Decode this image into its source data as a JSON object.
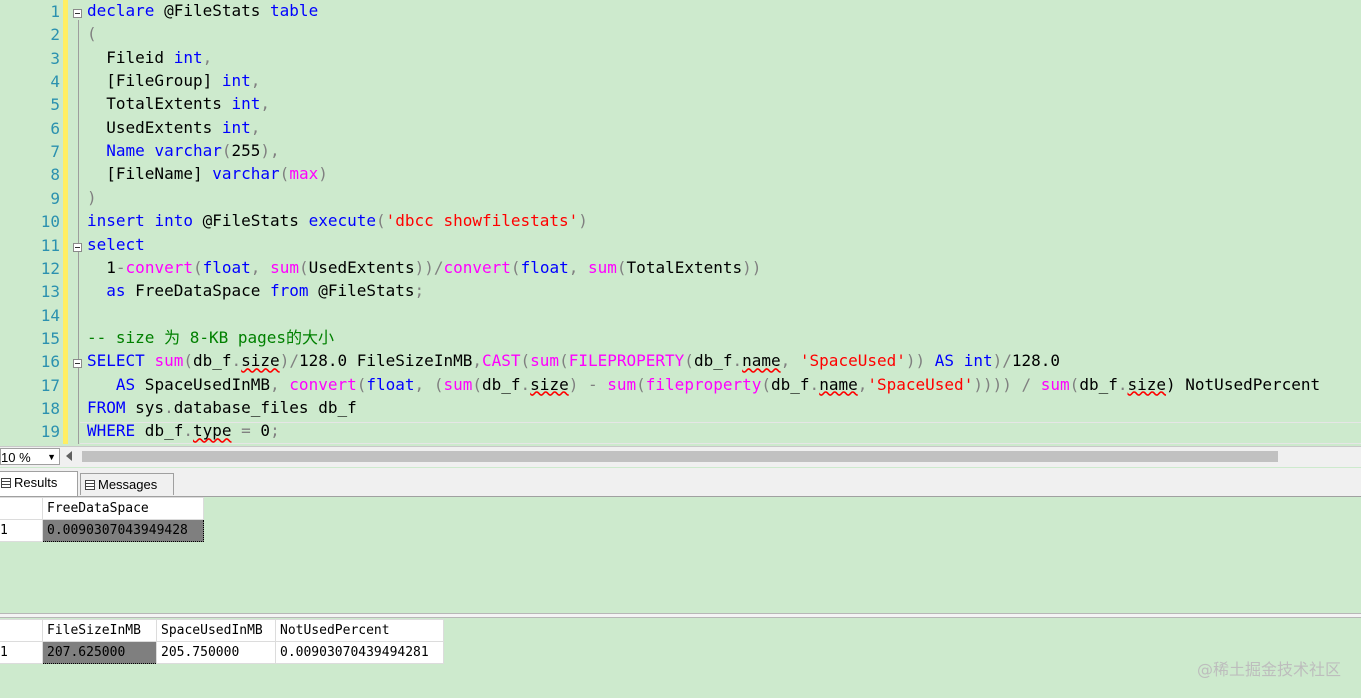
{
  "editor": {
    "line_numbers": [
      "1",
      "2",
      "3",
      "4",
      "5",
      "6",
      "7",
      "8",
      "9",
      "10",
      "11",
      "12",
      "13",
      "14",
      "15",
      "16",
      "17",
      "18",
      "19"
    ],
    "lines": [
      [
        {
          "t": "declare",
          "c": "kw"
        },
        {
          "t": " @FileStats ",
          "c": ""
        },
        {
          "t": "table",
          "c": "kw"
        }
      ],
      [
        {
          "t": "(",
          "c": "gr"
        }
      ],
      [
        {
          "t": "  Fileid ",
          "c": ""
        },
        {
          "t": "int",
          "c": "kw"
        },
        {
          "t": ",",
          "c": "gr"
        }
      ],
      [
        {
          "t": "  [FileGroup] ",
          "c": ""
        },
        {
          "t": "int",
          "c": "kw"
        },
        {
          "t": ",",
          "c": "gr"
        }
      ],
      [
        {
          "t": "  TotalExtents ",
          "c": ""
        },
        {
          "t": "int",
          "c": "kw"
        },
        {
          "t": ",",
          "c": "gr"
        }
      ],
      [
        {
          "t": "  UsedExtents ",
          "c": ""
        },
        {
          "t": "int",
          "c": "kw"
        },
        {
          "t": ",",
          "c": "gr"
        }
      ],
      [
        {
          "t": "  ",
          "c": ""
        },
        {
          "t": "Name",
          "c": "kw"
        },
        {
          "t": " ",
          "c": ""
        },
        {
          "t": "varchar",
          "c": "kw"
        },
        {
          "t": "(",
          "c": "gr"
        },
        {
          "t": "255",
          "c": ""
        },
        {
          "t": "),",
          "c": "gr"
        }
      ],
      [
        {
          "t": "  [FileName] ",
          "c": ""
        },
        {
          "t": "varchar",
          "c": "kw"
        },
        {
          "t": "(",
          "c": "gr"
        },
        {
          "t": "max",
          "c": "fn"
        },
        {
          "t": ")",
          "c": "gr"
        }
      ],
      [
        {
          "t": ")",
          "c": "gr"
        }
      ],
      [
        {
          "t": "insert",
          "c": "kw"
        },
        {
          "t": " ",
          "c": ""
        },
        {
          "t": "into",
          "c": "kw"
        },
        {
          "t": " @FileStats ",
          "c": ""
        },
        {
          "t": "execute",
          "c": "kw"
        },
        {
          "t": "(",
          "c": "gr"
        },
        {
          "t": "'dbcc showfilestats'",
          "c": "str"
        },
        {
          "t": ")",
          "c": "gr"
        }
      ],
      [
        {
          "t": "select",
          "c": "kw"
        }
      ],
      [
        {
          "t": "  1",
          "c": ""
        },
        {
          "t": "-",
          "c": "gr"
        },
        {
          "t": "convert",
          "c": "fn"
        },
        {
          "t": "(",
          "c": "gr"
        },
        {
          "t": "float",
          "c": "kw"
        },
        {
          "t": ", ",
          "c": "gr"
        },
        {
          "t": "sum",
          "c": "fn"
        },
        {
          "t": "(",
          "c": "gr"
        },
        {
          "t": "UsedExtents",
          "c": ""
        },
        {
          "t": "))/",
          "c": "gr"
        },
        {
          "t": "convert",
          "c": "fn"
        },
        {
          "t": "(",
          "c": "gr"
        },
        {
          "t": "float",
          "c": "kw"
        },
        {
          "t": ", ",
          "c": "gr"
        },
        {
          "t": "sum",
          "c": "fn"
        },
        {
          "t": "(",
          "c": "gr"
        },
        {
          "t": "TotalExtents",
          "c": ""
        },
        {
          "t": "))",
          "c": "gr"
        }
      ],
      [
        {
          "t": "  ",
          "c": ""
        },
        {
          "t": "as",
          "c": "kw"
        },
        {
          "t": " FreeDataSpace ",
          "c": ""
        },
        {
          "t": "from",
          "c": "kw"
        },
        {
          "t": " @FileStats",
          "c": ""
        },
        {
          "t": ";",
          "c": "gr"
        }
      ],
      [],
      [
        {
          "t": "-- size 为 8-KB pages的大小",
          "c": "cm"
        }
      ],
      [
        {
          "t": "SELECT",
          "c": "kw"
        },
        {
          "t": " ",
          "c": ""
        },
        {
          "t": "sum",
          "c": "fn"
        },
        {
          "t": "(",
          "c": "gr"
        },
        {
          "t": "db_f",
          "c": ""
        },
        {
          "t": ".",
          "c": "gr"
        },
        {
          "t": "size",
          "c": "sq"
        },
        {
          "t": ")/",
          "c": "gr"
        },
        {
          "t": "128.0 FileSizeInMB",
          "c": ""
        },
        {
          "t": ",",
          "c": "gr"
        },
        {
          "t": "CAST",
          "c": "fn"
        },
        {
          "t": "(",
          "c": "gr"
        },
        {
          "t": "sum",
          "c": "fn"
        },
        {
          "t": "(",
          "c": "gr"
        },
        {
          "t": "FILEPROPERTY",
          "c": "fn"
        },
        {
          "t": "(",
          "c": "gr"
        },
        {
          "t": "db_f",
          "c": ""
        },
        {
          "t": ".",
          "c": "gr"
        },
        {
          "t": "name",
          "c": "sq"
        },
        {
          "t": ", ",
          "c": "gr"
        },
        {
          "t": "'SpaceUsed'",
          "c": "str"
        },
        {
          "t": ")) ",
          "c": "gr"
        },
        {
          "t": "AS",
          "c": "kw"
        },
        {
          "t": " ",
          "c": ""
        },
        {
          "t": "int",
          "c": "kw"
        },
        {
          "t": ")/",
          "c": "gr"
        },
        {
          "t": "128.0",
          "c": ""
        }
      ],
      [
        {
          "t": "   ",
          "c": ""
        },
        {
          "t": "AS",
          "c": "kw"
        },
        {
          "t": " SpaceUsedInMB",
          "c": ""
        },
        {
          "t": ", ",
          "c": "gr"
        },
        {
          "t": "convert",
          "c": "fn"
        },
        {
          "t": "(",
          "c": "gr"
        },
        {
          "t": "float",
          "c": "kw"
        },
        {
          "t": ", (",
          "c": "gr"
        },
        {
          "t": "sum",
          "c": "fn"
        },
        {
          "t": "(",
          "c": "gr"
        },
        {
          "t": "db_f",
          "c": ""
        },
        {
          "t": ".",
          "c": "gr"
        },
        {
          "t": "size",
          "c": "sq"
        },
        {
          "t": ") - ",
          "c": "gr"
        },
        {
          "t": "sum",
          "c": "fn"
        },
        {
          "t": "(",
          "c": "gr"
        },
        {
          "t": "fileproperty",
          "c": "fn"
        },
        {
          "t": "(",
          "c": "gr"
        },
        {
          "t": "db_f",
          "c": ""
        },
        {
          "t": ".",
          "c": "gr"
        },
        {
          "t": "name",
          "c": "sq"
        },
        {
          "t": ",",
          "c": "gr"
        },
        {
          "t": "'SpaceUsed'",
          "c": "str"
        },
        {
          "t": ")))) / ",
          "c": "gr"
        },
        {
          "t": "sum",
          "c": "fn"
        },
        {
          "t": "(",
          "c": "gr"
        },
        {
          "t": "db_f",
          "c": ""
        },
        {
          "t": ".",
          "c": "gr"
        },
        {
          "t": "size",
          "c": "sq"
        },
        {
          "t": ") NotUsedPercent",
          "c": ""
        }
      ],
      [
        {
          "t": "FROM",
          "c": "kw"
        },
        {
          "t": " sys",
          "c": ""
        },
        {
          "t": ".",
          "c": "gr"
        },
        {
          "t": "database_files db_f",
          "c": ""
        }
      ],
      [
        {
          "t": "WHERE",
          "c": "kw"
        },
        {
          "t": " db_f",
          "c": ""
        },
        {
          "t": ".",
          "c": "gr"
        },
        {
          "t": "type",
          "c": "sq"
        },
        {
          "t": " = ",
          "c": "gr"
        },
        {
          "t": "0",
          "c": ""
        },
        {
          "t": ";",
          "c": "gr"
        }
      ]
    ]
  },
  "zoom": {
    "value": "10 %"
  },
  "tabs": {
    "results_label": "Results",
    "messages_label": "Messages"
  },
  "grid1": {
    "headers": [
      "FreeDataSpace"
    ],
    "rows": [
      {
        "num": "1",
        "cells": [
          "0.0090307043949428"
        ]
      }
    ]
  },
  "grid2": {
    "headers": [
      "FileSizeInMB",
      "SpaceUsedInMB",
      "NotUsedPercent"
    ],
    "rows": [
      {
        "num": "1",
        "cells": [
          "207.625000",
          "205.750000",
          "0.00903070439494281"
        ]
      }
    ]
  },
  "watermark": "@稀土掘金技术社区"
}
